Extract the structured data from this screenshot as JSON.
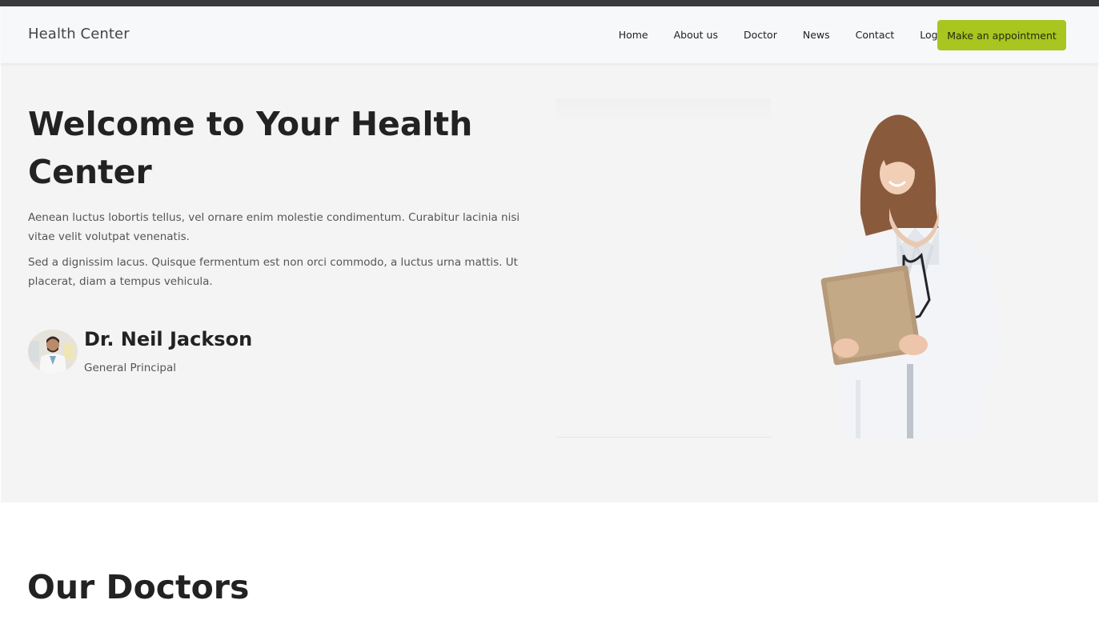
{
  "header": {
    "brand": "Health Center",
    "nav": [
      "Home",
      "About us",
      "Doctor",
      "News",
      "Contact",
      "Login"
    ],
    "cta_label": "Make an appointment"
  },
  "hero": {
    "title": "Welcome to Your Health Center",
    "paragraph_1": "Aenean luctus lobortis tellus, vel ornare enim molestie condimentum. Curabitur lacinia nisi vitae velit volutpat venenatis.",
    "paragraph_2": "Sed a dignissim lacus. Quisque fermentum est non orci commodo, a luctus urna mattis. Ut placerat, diam a tempus vehicula.",
    "doctor": {
      "name": "Dr. Neil Jackson",
      "role": "General Principal"
    }
  },
  "doctors_section": {
    "title": "Our Doctors"
  },
  "colors": {
    "accent": "#a9c51f",
    "top_strip": "#3a3a3d",
    "hero_bg": "#f4f4f4",
    "nav_bg": "#f7f8fa"
  }
}
